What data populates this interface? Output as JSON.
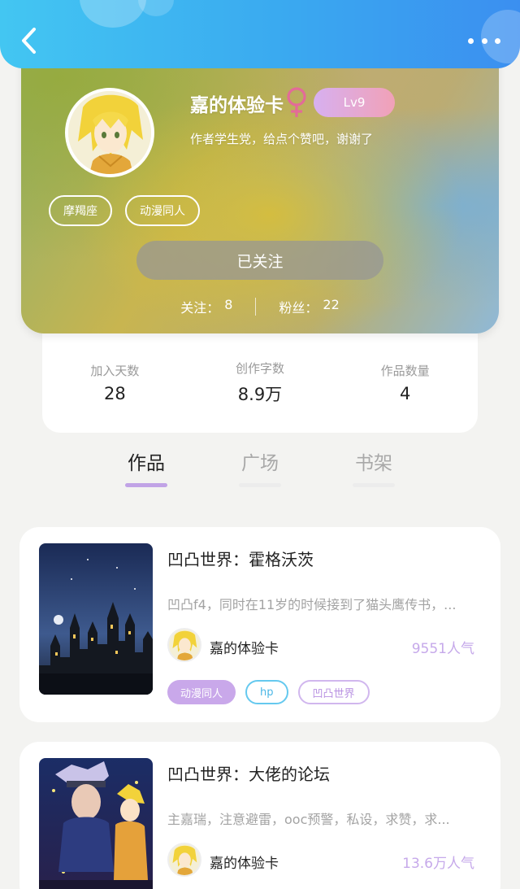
{
  "profile": {
    "username": "嘉的体验卡",
    "level": "Lv9",
    "bio": "作者学生党，给点个赞吧，谢谢了",
    "tags": [
      "摩羯座",
      "动漫同人"
    ],
    "follow_button": "已关注",
    "following_label": "关注：",
    "following_count": "8",
    "fans_label": "粉丝：",
    "fans_count": "22"
  },
  "stats": [
    {
      "label": "加入天数",
      "value": "28"
    },
    {
      "label": "创作字数",
      "value": "8.9万"
    },
    {
      "label": "作品数量",
      "value": "4"
    }
  ],
  "tabs": [
    {
      "label": "作品",
      "active": true
    },
    {
      "label": "广场",
      "active": false
    },
    {
      "label": "书架",
      "active": false
    }
  ],
  "works": [
    {
      "title": "凹凸世界：霍格沃茨",
      "description": "凹凸f4，同时在11岁的时候接到了猫头鹰传书，...",
      "author": "嘉的体验卡",
      "popularity": "9551人气",
      "tags": [
        "动漫同人",
        "hp",
        "凹凸世界"
      ]
    },
    {
      "title": "凹凸世界：大佬的论坛",
      "description": "主嘉瑞，注意避雷，ooc预警，私设，求赞，求...",
      "author": "嘉的体验卡",
      "popularity": "13.6万人气"
    }
  ],
  "icons": {
    "back": "chevron-left-icon",
    "more": "more-horizontal-icon",
    "gender": "female-symbol-icon"
  },
  "colors": {
    "topbar": "#3aa9f0",
    "accent_purple": "#c1a3e6",
    "gender_pink": "#e36b98",
    "tag_blue": "#4bb7e6"
  }
}
